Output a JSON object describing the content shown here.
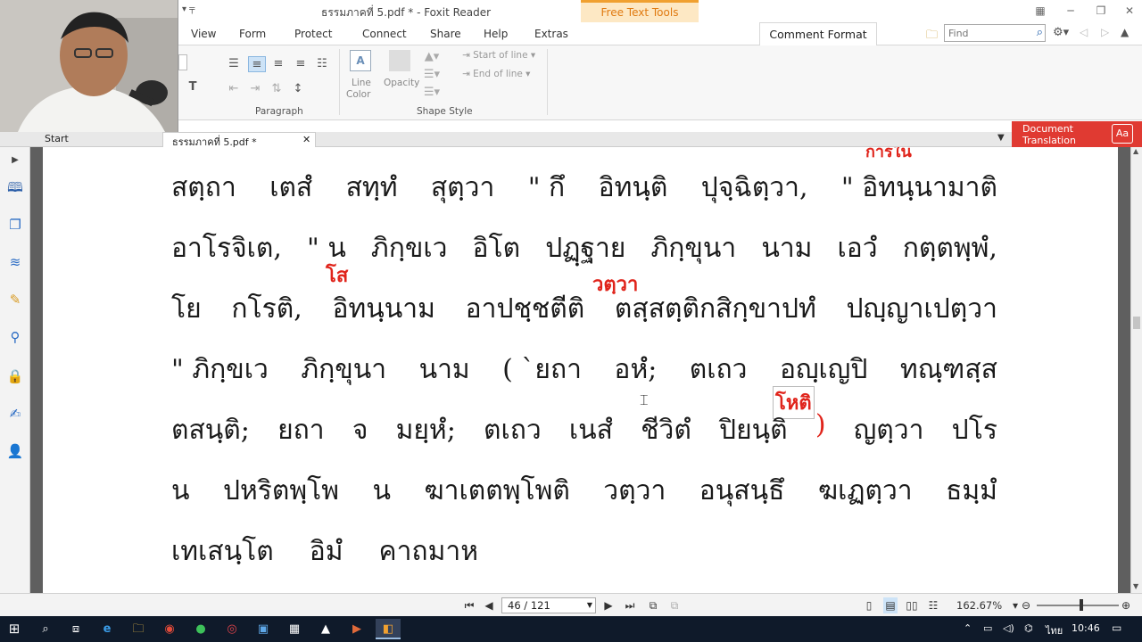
{
  "window": {
    "title": "ธรรมภาคที่ 5.pdf * - Foxit Reader",
    "contextual_tab": "Free Text Tools",
    "quick_access": "▾ ╤"
  },
  "menu": {
    "tabs": [
      "View",
      "Form",
      "Protect",
      "Connect",
      "Share",
      "Help",
      "Extras"
    ],
    "active_tab": "Comment Format",
    "find_placeholder": "Find"
  },
  "ribbon": {
    "paragraph_label": "Paragraph",
    "shape_style_label": "Shape Style",
    "line_color_label_1": "Line",
    "line_color_label_2": "Color",
    "opacity_label": "Opacity",
    "start_of_line": "Start of line",
    "end_of_line": "End of line",
    "text_tool": "T"
  },
  "doc_tabs": {
    "start_tab": "Start",
    "file_tab": "ธรรมภาคที่ 5.pdf *",
    "close_glyph": "✕",
    "document_translation_1": "Document",
    "document_translation_2": "Translation"
  },
  "document": {
    "lines": [
      [
        "สตฺถา",
        "เตสํ",
        "สทฺทํ",
        "สุตฺวา",
        "\" กึ",
        "อิทนฺติ",
        "ปุจฺฉิตฺวา,",
        "\" อิทนฺนามาติ"
      ],
      [
        "อาโรจิเต,",
        "\" น",
        "ภิกฺขเว",
        "อิโต",
        "ปฏฺฐาย",
        "ภิกฺขุนา",
        "นาม",
        "เอวํ",
        "กตฺตพฺพํ,"
      ],
      [
        "โย",
        "กโรติ,",
        "อิทนฺนาม",
        "อาปชฺชตีติ",
        "ตสฺสตฺติกสิกฺขาปทํ",
        "ปญฺญาเปตฺวา"
      ],
      [
        "\" ภิกฺขเว",
        "ภิกฺขุนา",
        "นาม",
        "( `ยถา",
        "อหํ;",
        "ตเถว",
        "อญฺเญปิ",
        "ทณฺฑสฺส"
      ],
      [
        "ตสนฺติ;",
        "ยถา",
        "จ",
        "มยฺหํ;",
        "ตเถว",
        "เนสํ",
        "ชีวิตํ",
        "ปิยนฺติ",
        ")",
        "ญตฺวา",
        "ปโร"
      ],
      [
        "น",
        "ปหริตพฺโพ",
        "น",
        "ฆาเตตพฺโพติ",
        "วตฺวา",
        "อนุสนฺธึ",
        "ฆเฏตฺวา",
        "ธมฺมํ"
      ],
      [
        "เทเสนฺโต",
        "อิมํ",
        "คาถมาห"
      ]
    ],
    "annotations": {
      "top_partial": "การใน",
      "so": "โส",
      "watwa": "วตฺวา",
      "open_paren": "(",
      "hoti": "โหติ",
      "close_paren": ")"
    }
  },
  "status": {
    "page_indicator": "46 / 121",
    "zoom": "162.67%"
  },
  "taskbar": {
    "time": "10:46",
    "language": "ไทย"
  },
  "colors": {
    "accent_orange": "#f0a030",
    "annotation_red": "#e0241b",
    "translate_red": "#e03a32",
    "taskbar": "#0f1a2a"
  }
}
